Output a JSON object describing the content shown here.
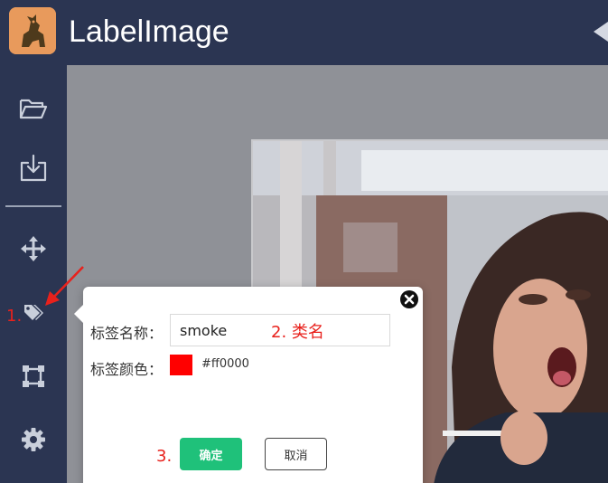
{
  "app": {
    "title": "LabelImage",
    "logo_icon": "dog-logo-icon"
  },
  "sidebar": {
    "tools": [
      {
        "name": "open-folder",
        "icon": "folder-open-icon"
      },
      {
        "name": "export",
        "icon": "download-tray-icon"
      },
      {
        "name": "move",
        "icon": "move-arrows-icon"
      },
      {
        "name": "label",
        "icon": "tags-icon"
      },
      {
        "name": "rectangle",
        "icon": "rectangle-select-icon"
      },
      {
        "name": "settings",
        "icon": "gear-icon"
      }
    ]
  },
  "annotations": {
    "step1": "1.",
    "step2": "2. 类名",
    "step3": "3."
  },
  "dialog": {
    "name_label": "标签名称：",
    "name_value": "smoke",
    "color_label": "标签颜色：",
    "color_value": "#ff0000",
    "color_hex_text": "#ff0000",
    "ok_label": "确定",
    "cancel_label": "取消"
  },
  "colors": {
    "header_bg": "#2b3552",
    "accent_green": "#1fc17a",
    "annotation_red": "#e8211c"
  }
}
